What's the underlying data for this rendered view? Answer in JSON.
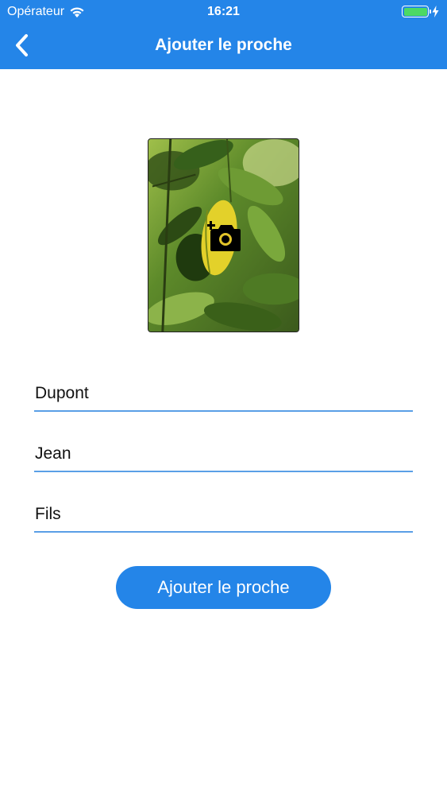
{
  "status_bar": {
    "carrier": "Opérateur",
    "time": "16:21",
    "battery_color": "#4cd964"
  },
  "nav": {
    "back_icon": "chevron-left-icon",
    "title": "Ajouter le proche",
    "background": "#2485e8"
  },
  "photo": {
    "add_photo_icon": "camera-plus-icon"
  },
  "form": {
    "last_name": {
      "value": "Dupont"
    },
    "first_name": {
      "value": "Jean"
    },
    "relation": {
      "value": "Fils"
    },
    "submit_label": "Ajouter le proche"
  }
}
